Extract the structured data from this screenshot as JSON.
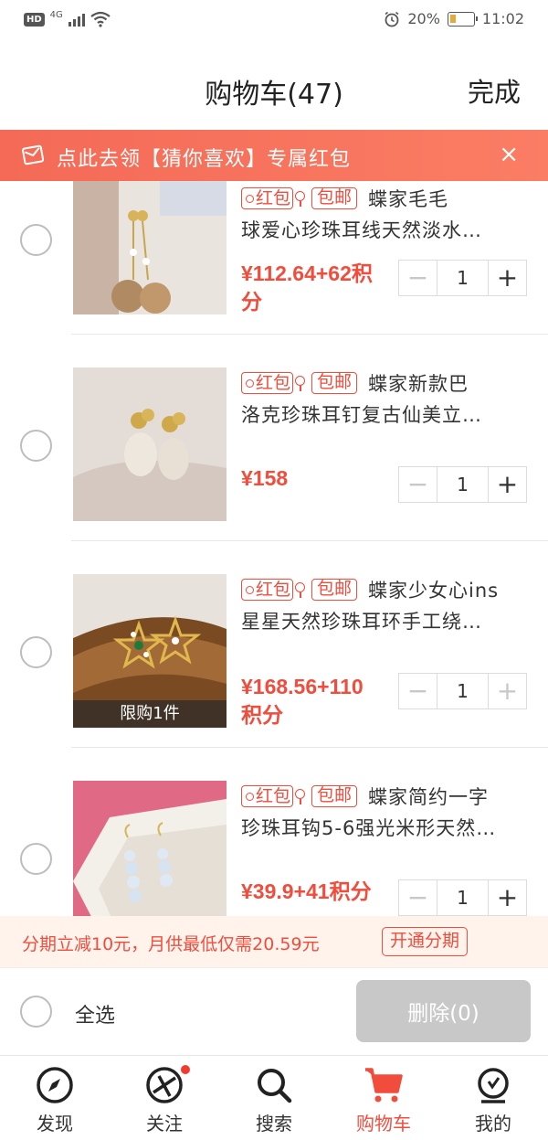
{
  "status_bar": {
    "hd": "HD",
    "network": "4G",
    "battery_percent": "20%",
    "time": "11:02",
    "icons": [
      "signal-icon",
      "wifi-icon",
      "alarm-icon",
      "battery-icon"
    ]
  },
  "header": {
    "title": "购物车(47)",
    "done_label": "完成"
  },
  "banner": {
    "text": "点此去领【猜你喜欢】专属红包",
    "close_glyph": "×",
    "color": "#f46a56"
  },
  "tags": {
    "hongbao": "红包",
    "baoyou": "包邮"
  },
  "items": [
    {
      "line1": "蝶家毛毛",
      "line2": "球爱心珍珠耳线天然淡水…",
      "price_line1": "¥112.64+62积",
      "price_line2": "分",
      "qty": "1",
      "limit": "",
      "plus_enabled": true
    },
    {
      "line1": "蝶家新款巴",
      "line2": "洛克珍珠耳钉复古仙美立…",
      "price_line1": "¥158",
      "price_line2": "",
      "qty": "1",
      "limit": "",
      "plus_enabled": true
    },
    {
      "line1": "蝶家少女心ins",
      "line2": "星星天然珍珠耳环手工绕…",
      "price_line1": "¥168.56+110",
      "price_line2": "积分",
      "qty": "1",
      "limit": "限购1件",
      "plus_enabled": false
    },
    {
      "line1": "蝶家简约一字",
      "line2": "珍珠耳钩5-6强光米形天然…",
      "price_line1": "¥39.9+41积分",
      "price_line2": "",
      "qty": "1",
      "limit": "",
      "plus_enabled": true
    }
  ],
  "stepper": {
    "minus": "−",
    "plus": "+"
  },
  "installment": {
    "text": "分期立减10元，月供最低仅需20.59元",
    "button": "开通分期"
  },
  "actions": {
    "select_all": "全选",
    "delete": "删除(0)"
  },
  "nav": {
    "tabs": [
      {
        "label": "发现",
        "icon": "compass-icon"
      },
      {
        "label": "关注",
        "icon": "follow-icon"
      },
      {
        "label": "搜索",
        "icon": "search-icon"
      },
      {
        "label": "购物车",
        "icon": "cart-icon",
        "active": true
      },
      {
        "label": "我的",
        "icon": "profile-icon"
      }
    ]
  },
  "colors": {
    "accent": "#f14c3c",
    "disabled": "#c8c8c8"
  }
}
